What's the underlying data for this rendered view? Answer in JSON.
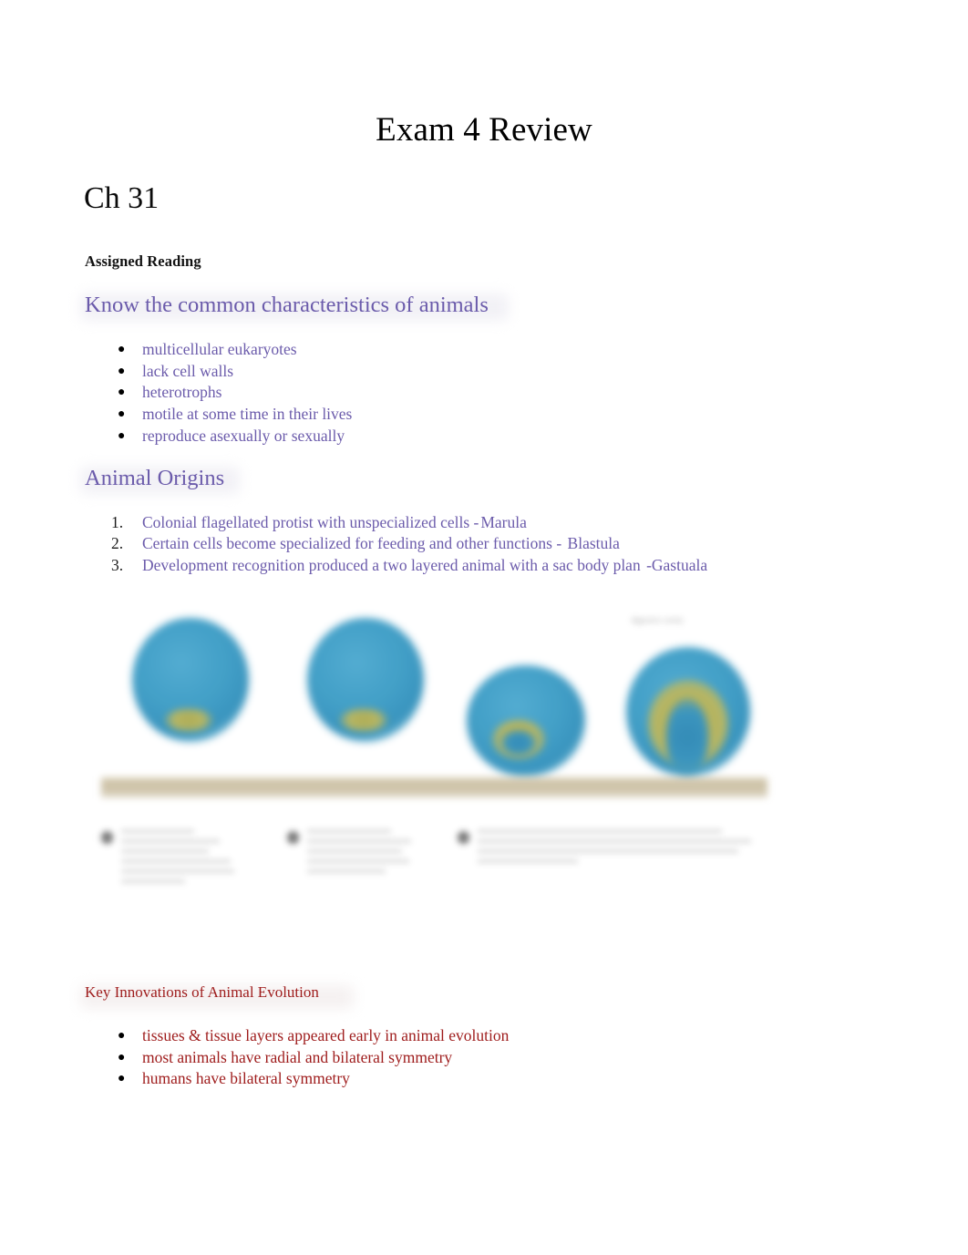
{
  "document": {
    "title": "Exam 4 Review",
    "chapter": "Ch 31",
    "assigned_reading": "Assigned Reading"
  },
  "colors": {
    "purple": "#6b5bab",
    "dark_red": "#9e1b1b",
    "highlight_yellow": "#fbe3a0",
    "figure_blue": "#3a9cc6",
    "figure_olive": "#b5b35a",
    "figure_band_tan": "#c9bda0",
    "black": "#000000"
  },
  "sections": {
    "animal_characteristics": {
      "heading": "Know the common characteristics of animals",
      "items": [
        "multicellular eukaryotes",
        "lack cell walls",
        "heterotrophs",
        "motile at some time in their lives",
        "reproduce asexually or sexually"
      ]
    },
    "animal_origins": {
      "heading": "Animal Origins",
      "items": [
        {
          "number": "1.",
          "text": "Colonial flagellated protist with unspecialized cells -",
          "highlight": "Marula"
        },
        {
          "number": "2.",
          "text": "Certain cells become specialized for feeding and other functions - ",
          "highlight": "Blastula"
        },
        {
          "number": "3.",
          "text": "Development recognition produced a two layered animal with a sac body plan   ",
          "highlight": "-Gastuala"
        }
      ]
    },
    "key_innovations": {
      "heading": "Key Innovations of Animal Evolution",
      "items": [
        "tissues & tissue layers appeared early in animal evolution",
        "most animals have  radial and bilateral symmetry",
        "humans have bilateral symmetry"
      ]
    }
  },
  "figure": {
    "description": "animal-development-stages-diagram",
    "stages": [
      {
        "name": "colonial-protist-stage"
      },
      {
        "name": "blastula-stage"
      },
      {
        "name": "early-gastrula-stage"
      },
      {
        "name": "gastrula-stage"
      }
    ],
    "stage_label": "digestive cavity",
    "band_segments": [
      "",
      "",
      "",
      ""
    ],
    "caption_blocks": [
      {
        "badge": "1"
      },
      {
        "badge": "2"
      },
      {
        "badge": "3"
      }
    ]
  }
}
